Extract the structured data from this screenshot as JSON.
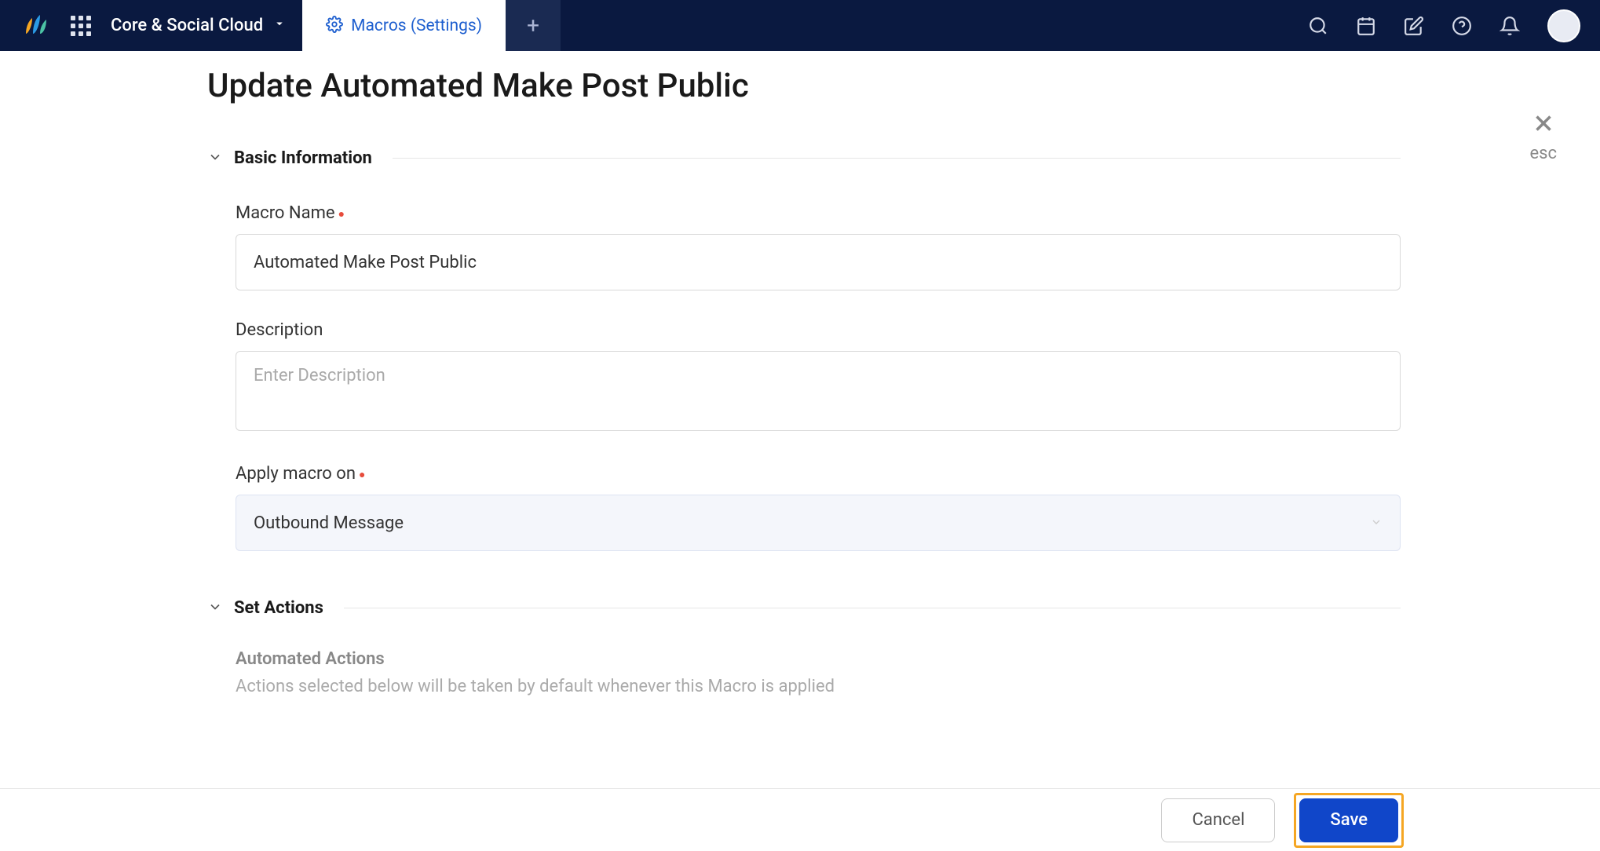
{
  "topbar": {
    "workspace": "Core & Social Cloud",
    "tab_label": "Macros (Settings)"
  },
  "close": {
    "esc": "esc"
  },
  "page": {
    "title": "Update Automated Make Post Public"
  },
  "sections": {
    "basic_info": "Basic Information",
    "set_actions": "Set Actions"
  },
  "fields": {
    "macro_name": {
      "label": "Macro Name",
      "value": "Automated Make Post Public"
    },
    "description": {
      "label": "Description",
      "placeholder": "Enter Description",
      "value": ""
    },
    "apply_on": {
      "label": "Apply macro on",
      "value": "Outbound Message"
    }
  },
  "automated_actions": {
    "title": "Automated Actions",
    "desc": "Actions selected below will be taken by default whenever this Macro is applied"
  },
  "footer": {
    "cancel": "Cancel",
    "save": "Save"
  }
}
